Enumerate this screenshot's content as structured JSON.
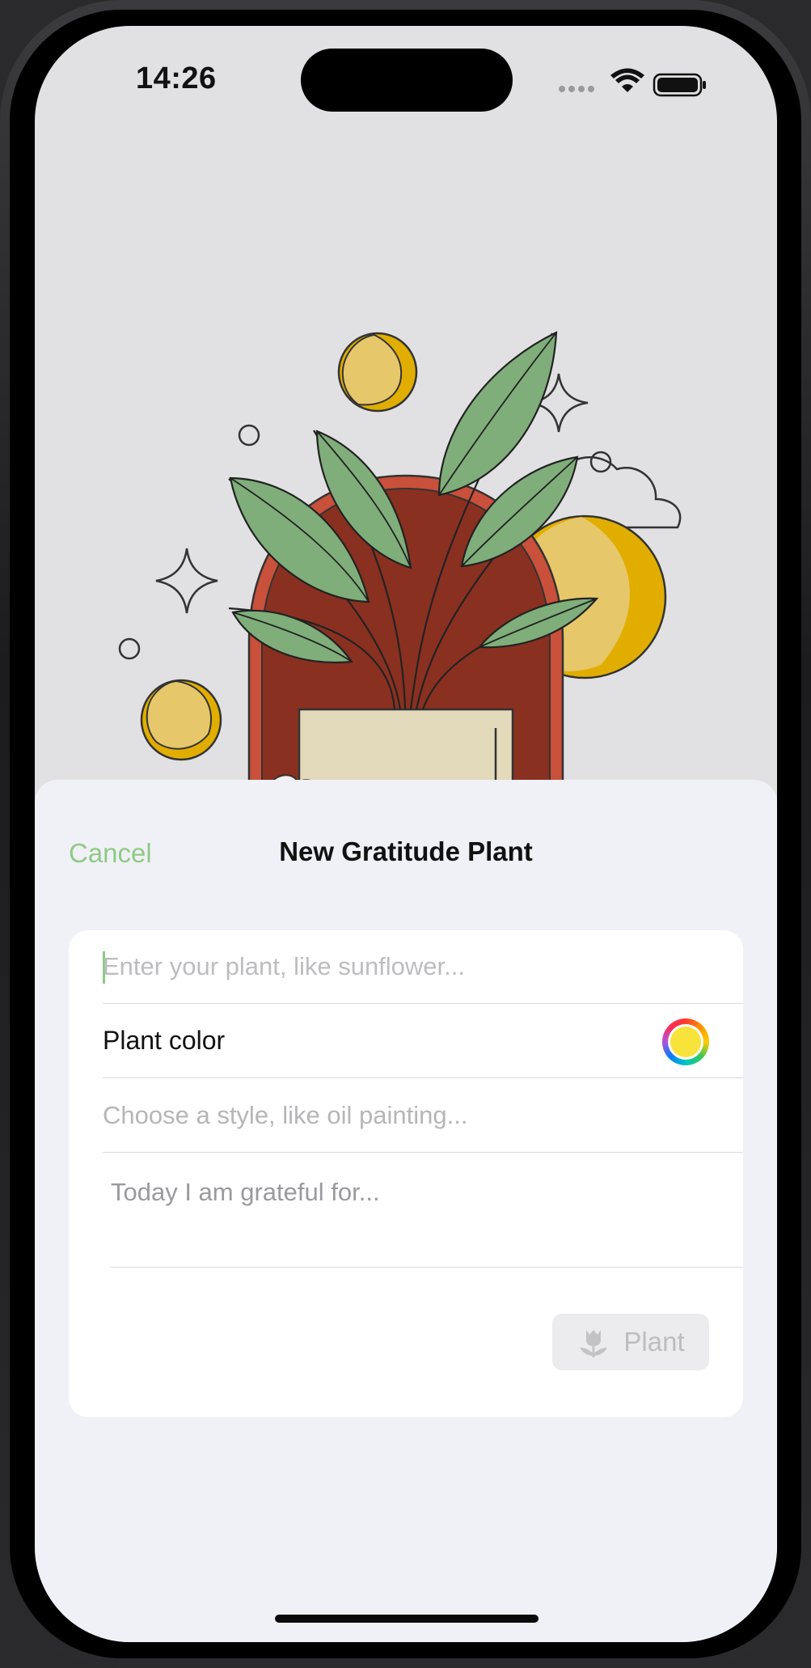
{
  "status_bar": {
    "time": "14:26",
    "icons": [
      "cellular-signal-icon",
      "wifi-icon",
      "battery-icon"
    ]
  },
  "illustration": {
    "description_icon": "plant-in-pot-illustration",
    "colors": {
      "leaf": "#7fae7a",
      "arch": "#8a3020",
      "arch_outline": "#c9503a",
      "sun": "#e6c76a",
      "sun_shadow": "#e1ae00",
      "pot": "#e3dabb"
    }
  },
  "sheet": {
    "cancel_label": "Cancel",
    "title": "New Gratitude Plant"
  },
  "form": {
    "plant_name": {
      "value": "",
      "placeholder": "Enter your plant, like sunflower..."
    },
    "plant_color": {
      "label": "Plant color",
      "value": "#f8e33a"
    },
    "style": {
      "value": "",
      "placeholder": "Choose a style, like oil painting..."
    },
    "gratitude": {
      "value": "",
      "placeholder": "Today I am grateful for..."
    },
    "submit": {
      "label": "Plant",
      "icon": "tulip-icon",
      "enabled": false
    }
  },
  "theme": {
    "accent": "#8fca86",
    "sheet_bg": "#f0f1f6",
    "card_bg": "#ffffff"
  }
}
